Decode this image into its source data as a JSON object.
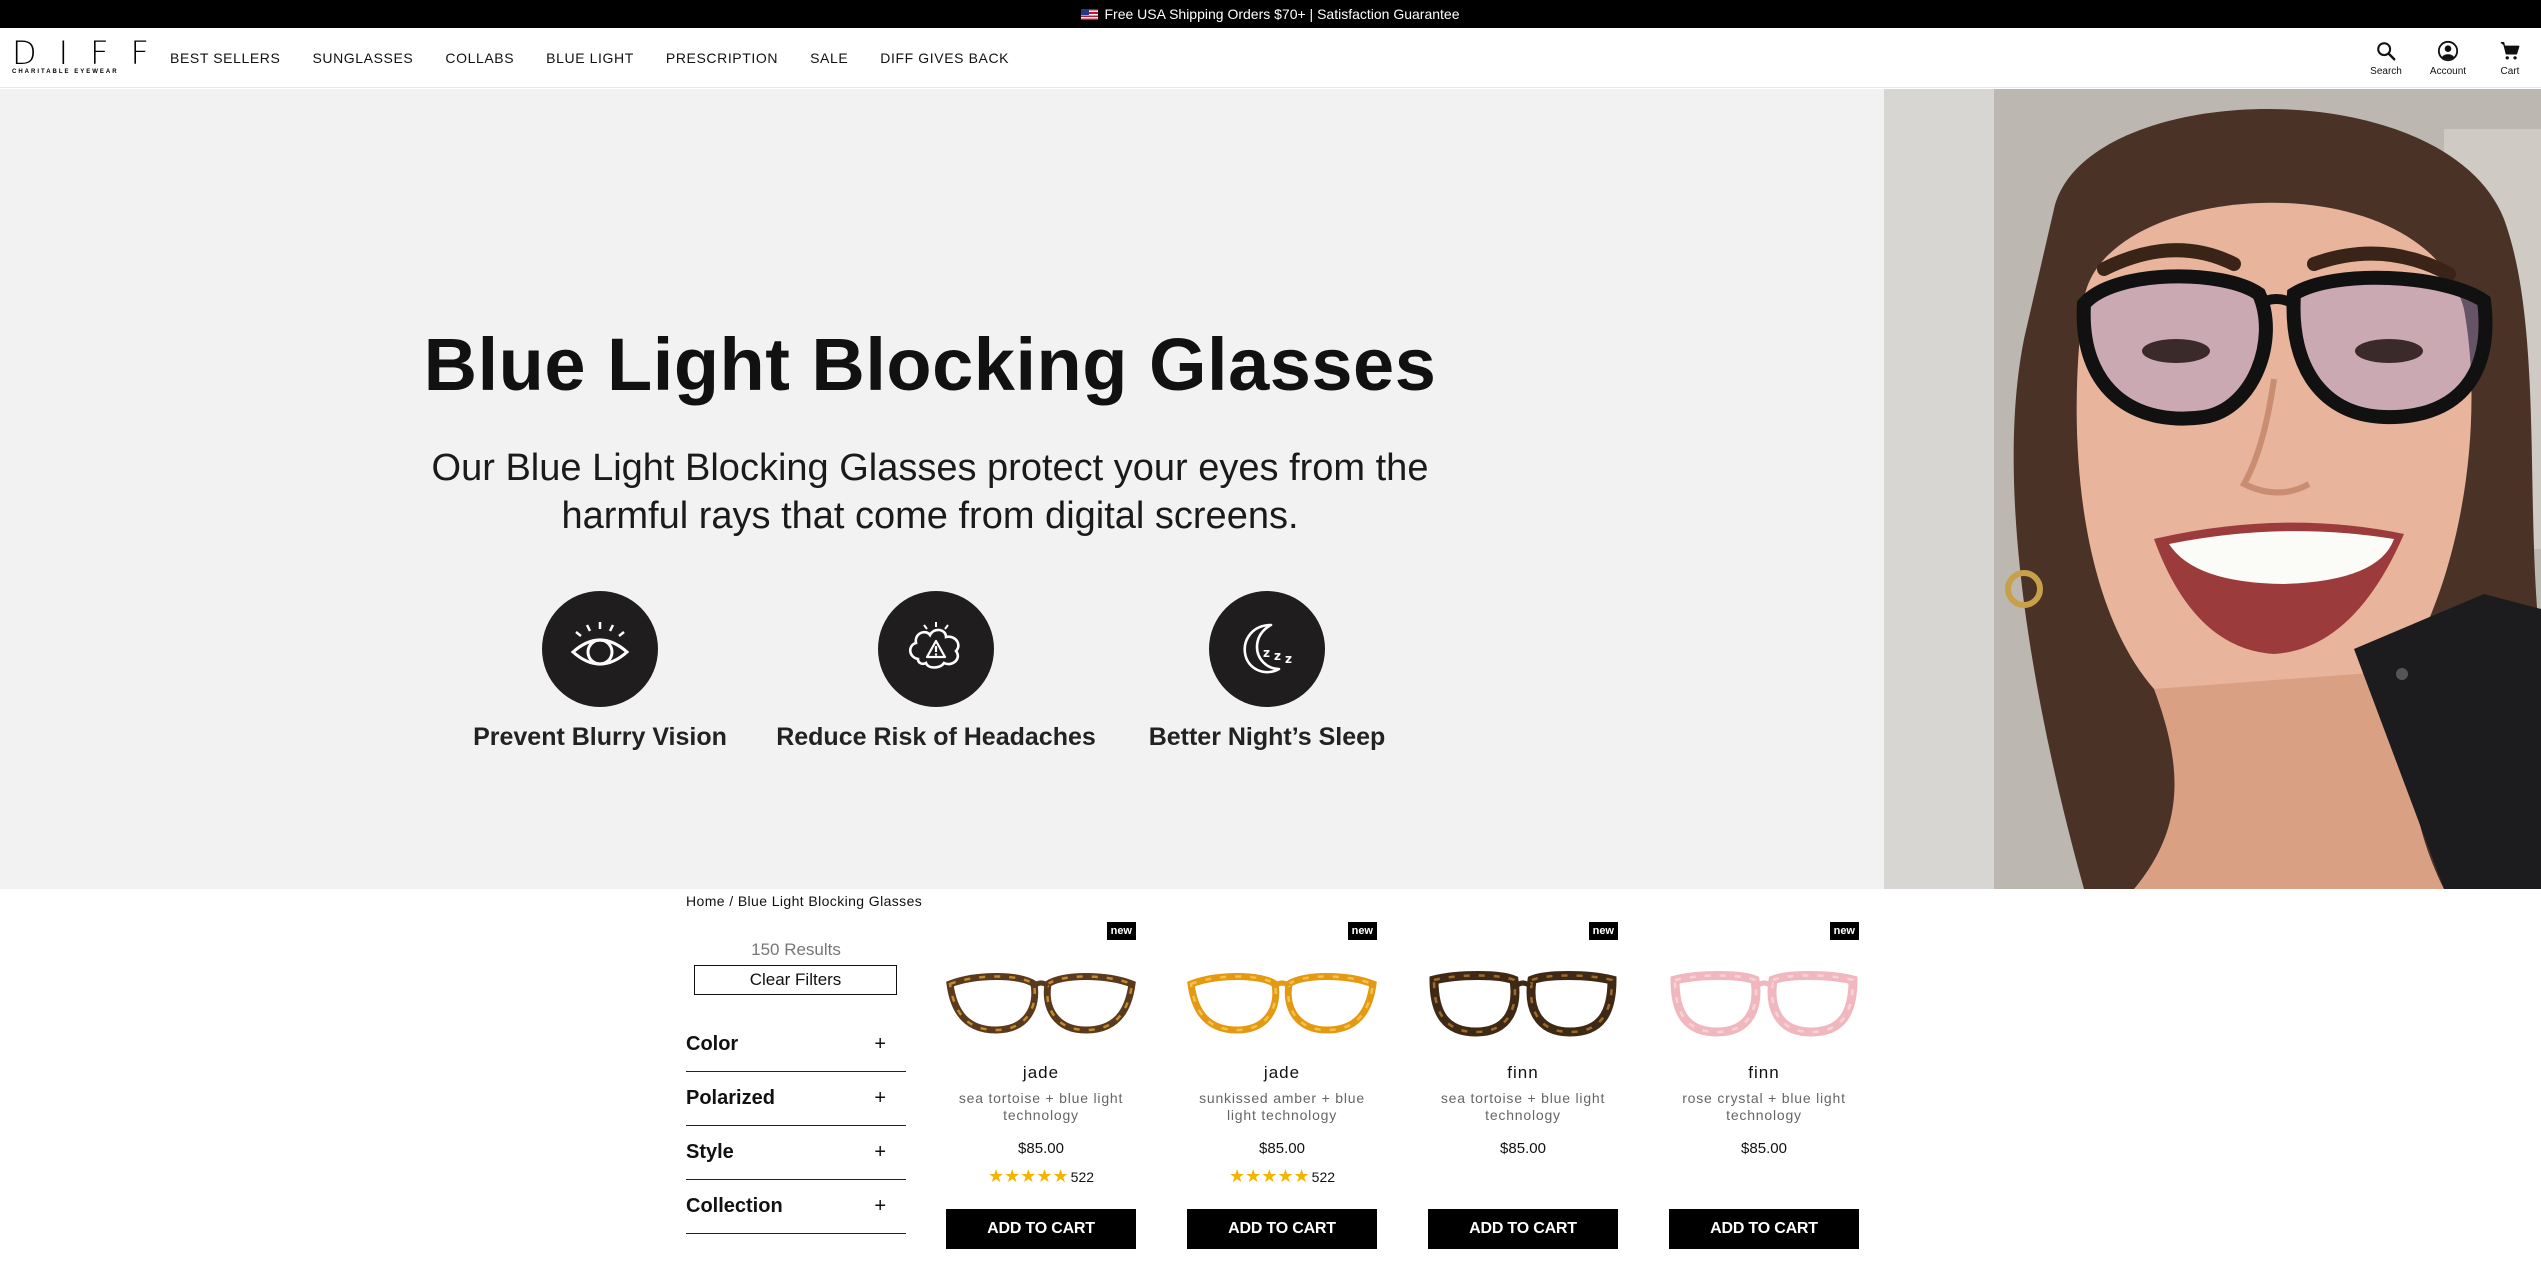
{
  "banner": {
    "text": "Free USA Shipping Orders $70+ | Satisfaction Guarantee",
    "icon": "us-flag-icon"
  },
  "nav": {
    "logo": {
      "main": "DIFF",
      "sub": "CHARITABLE EYEWEAR"
    },
    "menu": [
      "BEST SELLERS",
      "SUNGLASSES",
      "COLLABS",
      "BLUE LIGHT",
      "PRESCRIPTION",
      "SALE",
      "DIFF GIVES BACK"
    ],
    "icons": [
      {
        "label": "Search",
        "icon": "search-icon"
      },
      {
        "label": "Account",
        "icon": "account-icon"
      },
      {
        "label": "Cart",
        "icon": "cart-icon"
      }
    ]
  },
  "hero": {
    "title": "Blue Light Blocking Glasses",
    "subtitle": "Our Blue Light Blocking Glasses protect your eyes from the harmful rays that come from digital screens.",
    "benefits": [
      {
        "label": "Prevent Blurry Vision",
        "icon": "eye-icon"
      },
      {
        "label": "Reduce Risk of Headaches",
        "icon": "brain-warning-icon"
      },
      {
        "label": "Better Night’s Sleep",
        "icon": "moon-sleep-icon"
      }
    ]
  },
  "listing": {
    "breadcrumb": "Home / Blue Light Blocking Glasses",
    "results": "150 Results",
    "clear_filters": "Clear Filters",
    "filters": [
      "Color",
      "Polarized",
      "Style",
      "Collection"
    ],
    "filter_toggle": "+",
    "products": [
      {
        "badge": "new",
        "name": "jade",
        "color": "sea tortoise + blue light technology",
        "price": "$85.00",
        "rating": 5,
        "reviews": "522",
        "cta": "ADD TO CART",
        "frame_color": "#5a3a1c",
        "frame_accent": "#c48a2e",
        "shape": "cat-eye"
      },
      {
        "badge": "new",
        "name": "jade",
        "color": "sunkissed amber + blue light technology",
        "price": "$85.00",
        "rating": 5,
        "reviews": "522",
        "cta": "ADD TO CART",
        "frame_color": "#e39a12",
        "frame_accent": "#f6c04a",
        "shape": "cat-eye"
      },
      {
        "badge": "new",
        "name": "finn",
        "color": "sea tortoise + blue light technology",
        "price": "$85.00",
        "rating": null,
        "reviews": null,
        "cta": "ADD TO CART",
        "frame_color": "#3e2a14",
        "frame_accent": "#9c6b2c",
        "shape": "square"
      },
      {
        "badge": "new",
        "name": "finn",
        "color": "rose crystal + blue light technology",
        "price": "$85.00",
        "rating": null,
        "reviews": null,
        "cta": "ADD TO CART",
        "frame_color": "#f0b8be",
        "frame_accent": "#f7d3d6",
        "shape": "square"
      }
    ]
  }
}
